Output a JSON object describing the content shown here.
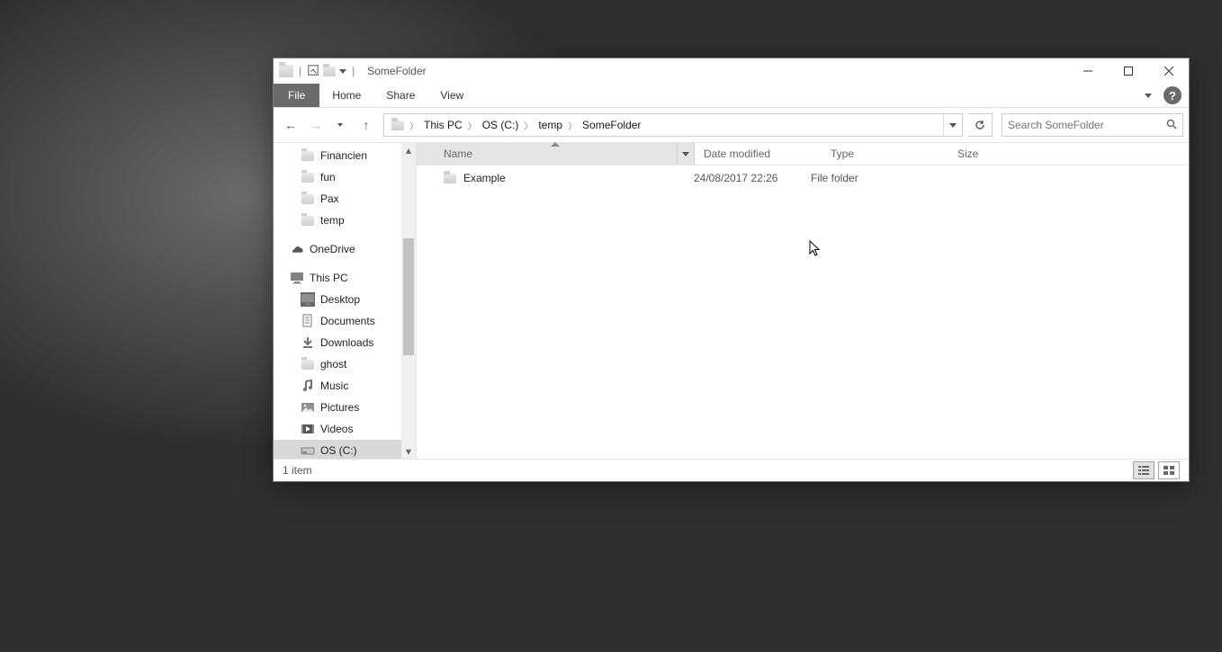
{
  "title": "SomeFolder",
  "ribbon_tabs": {
    "file": "File",
    "home": "Home",
    "share": "Share",
    "view": "View"
  },
  "breadcrumbs": [
    "This PC",
    "OS (C:)",
    "temp",
    "SomeFolder"
  ],
  "search": {
    "placeholder": "Search SomeFolder"
  },
  "sidebar": {
    "quick": [
      {
        "label": "Financien"
      },
      {
        "label": "fun"
      },
      {
        "label": "Pax"
      },
      {
        "label": "temp"
      }
    ],
    "onedrive": "OneDrive",
    "thispc": "This PC",
    "thispc_children": [
      {
        "label": "Desktop",
        "icon": "desktop"
      },
      {
        "label": "Documents",
        "icon": "docs"
      },
      {
        "label": "Downloads",
        "icon": "dl"
      },
      {
        "label": "ghost",
        "icon": "folder"
      },
      {
        "label": "Music",
        "icon": "music"
      },
      {
        "label": "Pictures",
        "icon": "pics"
      },
      {
        "label": "Videos",
        "icon": "video"
      },
      {
        "label": "OS (C:)",
        "icon": "drive",
        "selected": true
      }
    ]
  },
  "columns": {
    "name": "Name",
    "date": "Date modified",
    "type": "Type",
    "size": "Size"
  },
  "rows": [
    {
      "name": "Example",
      "date": "24/08/2017 22:26",
      "type": "File folder",
      "size": ""
    }
  ],
  "status": "1 item"
}
